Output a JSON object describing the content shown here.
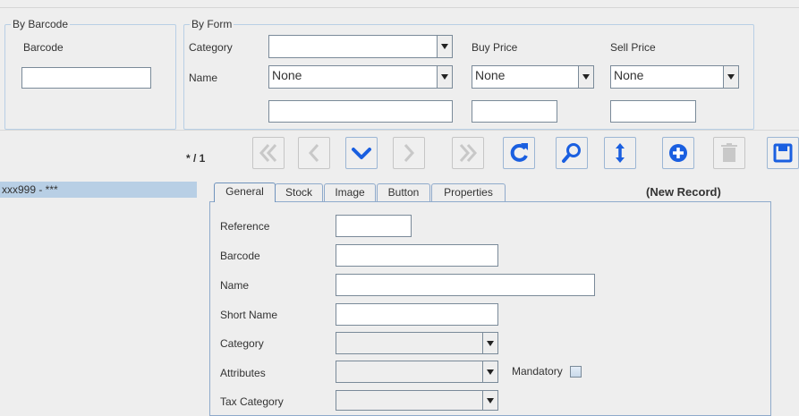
{
  "by_barcode": {
    "legend": "By Barcode",
    "barcode_label": "Barcode",
    "barcode_value": ""
  },
  "by_form": {
    "legend": "By Form",
    "category_label": "Category",
    "category_value": "",
    "name_label": "Name",
    "name_operator": "None",
    "name_value": "",
    "buy_price_label": "Buy Price",
    "buy_price_operator": "None",
    "buy_price_value": "",
    "sell_price_label": "Sell Price",
    "sell_price_operator": "None",
    "sell_price_value": ""
  },
  "navigator": {
    "record_counter": "* / 1",
    "buttons": [
      "first-icon",
      "previous-icon",
      "down-icon",
      "next-icon",
      "last-icon",
      "reload-icon",
      "search-icon",
      "sort-icon",
      "add-icon",
      "delete-icon",
      "save-icon"
    ],
    "colors": {
      "accent": "#1a5fe0",
      "disabled": "#c8c8c8"
    }
  },
  "record_list": {
    "items": [
      {
        "label": "xxx999 - ***"
      }
    ],
    "selected_bg": "#b8cfe5"
  },
  "tabs": [
    {
      "label": "General",
      "active": true
    },
    {
      "label": "Stock",
      "active": false
    },
    {
      "label": "Image",
      "active": false
    },
    {
      "label": "Button",
      "active": false
    },
    {
      "label": "Properties",
      "active": false
    }
  ],
  "record_status": "(New Record)",
  "general_form": {
    "reference_label": "Reference",
    "reference_value": "",
    "barcode_label": "Barcode",
    "barcode_value": "",
    "name_label": "Name",
    "name_value": "",
    "short_name_label": "Short Name",
    "short_name_value": "",
    "category_label": "Category",
    "category_value": "",
    "attributes_label": "Attributes",
    "attributes_value": "",
    "mandatory_label": "Mandatory",
    "mandatory_checked": false,
    "tax_category_label": "Tax Category",
    "tax_category_value": ""
  }
}
